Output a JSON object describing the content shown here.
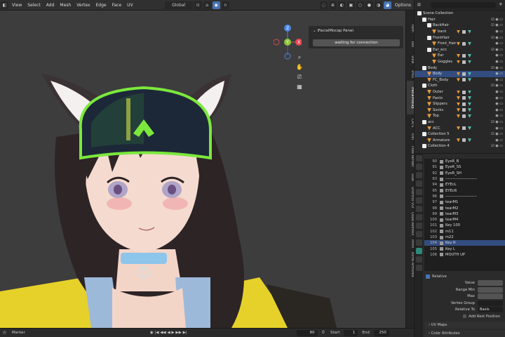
{
  "menubar": {
    "items": [
      "View",
      "Select",
      "Add",
      "Mesh",
      "Vertex",
      "Edge",
      "Face",
      "UV"
    ],
    "orientation": "Global",
    "options": "Options"
  },
  "viewport": {
    "gizmo": {
      "x": "X",
      "y": "Y",
      "z": "Z"
    }
  },
  "npanel": {
    "header": "iFacialMocap Panel",
    "status": "waiting for connection"
  },
  "sidetabs": [
    "Item",
    "Tool",
    "View",
    "VMD",
    "iFacialMocap",
    "CATS",
    "Edit",
    "Pose Render",
    "SSW",
    "Shortcut VUr",
    "Quad Remesh",
    "MMM",
    "BVHB Armored"
  ],
  "outliner": {
    "header": "Scene Collection",
    "rows": [
      {
        "depth": 1,
        "icon": "coll",
        "label": "Hair"
      },
      {
        "depth": 2,
        "icon": "coll",
        "label": "BackHair"
      },
      {
        "depth": 3,
        "icon": "obj",
        "label": "back"
      },
      {
        "depth": 2,
        "icon": "coll",
        "label": "FrontHair"
      },
      {
        "depth": 3,
        "icon": "obj",
        "label": "Front_Hair"
      },
      {
        "depth": 2,
        "icon": "coll",
        "label": "Ear_ecc"
      },
      {
        "depth": 3,
        "icon": "obj",
        "label": "Ear"
      },
      {
        "depth": 3,
        "icon": "obj",
        "label": "Goggles"
      },
      {
        "depth": 1,
        "icon": "coll",
        "label": "Body"
      },
      {
        "depth": 2,
        "icon": "obj",
        "label": "Body"
      },
      {
        "depth": 2,
        "icon": "obj",
        "label": "FC_Body"
      },
      {
        "depth": 1,
        "icon": "coll",
        "label": "Cloth"
      },
      {
        "depth": 2,
        "icon": "obj",
        "label": "Outer"
      },
      {
        "depth": 2,
        "icon": "obj",
        "label": "Pants"
      },
      {
        "depth": 2,
        "icon": "obj",
        "label": "Slippers"
      },
      {
        "depth": 2,
        "icon": "obj",
        "label": "Socks"
      },
      {
        "depth": 2,
        "icon": "obj",
        "label": "Top"
      },
      {
        "depth": 1,
        "icon": "coll",
        "label": "acc"
      },
      {
        "depth": 2,
        "icon": "obj",
        "label": "ACC"
      },
      {
        "depth": 1,
        "icon": "coll",
        "label": "Collection 5"
      },
      {
        "depth": 2,
        "icon": "obj",
        "label": "Armature"
      },
      {
        "depth": 1,
        "icon": "coll",
        "label": "Collection 4"
      }
    ]
  },
  "shapekeys": [
    {
      "num": "90",
      "name": "EyeR_B"
    },
    {
      "num": "91",
      "name": "EyeR_SS"
    },
    {
      "num": "92",
      "name": "EyeR_SH"
    },
    {
      "num": "93",
      "name": "------------------------"
    },
    {
      "num": "94",
      "name": "EYEcL"
    },
    {
      "num": "95",
      "name": "EYEcR"
    },
    {
      "num": "96",
      "name": "------------------------"
    },
    {
      "num": "97",
      "name": "tearM1"
    },
    {
      "num": "98",
      "name": "tearM2"
    },
    {
      "num": "99",
      "name": "tearM3"
    },
    {
      "num": "100",
      "name": "tearM4"
    },
    {
      "num": "101",
      "name": "Key 100"
    },
    {
      "num": "102",
      "name": "m11"
    },
    {
      "num": "103",
      "name": "m22"
    },
    {
      "num": "104",
      "name": "Key R"
    },
    {
      "num": "105",
      "name": "Key L"
    },
    {
      "num": "106",
      "name": "MOUTH UP"
    }
  ],
  "properties": {
    "relative": "Relative",
    "value_label": "Value",
    "range_min_label": "Range Min",
    "max_label": "Max",
    "vertex_group_label": "Vertex Group",
    "relative_to_label": "Relative To",
    "relative_to_value": "Basis",
    "add_rest": "Add Rest Position",
    "uv_maps": "UV Maps",
    "color_attributes": "Color Attributes"
  },
  "timeline": {
    "marker": "Marker",
    "current_frame": "80",
    "start_label": "Start",
    "start": "1",
    "end_label": "End",
    "end": "250"
  }
}
